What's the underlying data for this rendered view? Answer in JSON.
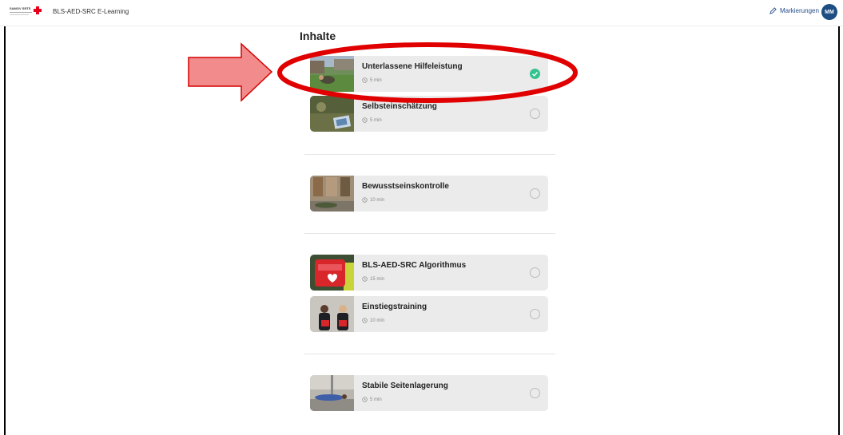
{
  "header": {
    "logo_text": "SAMOV SRTS",
    "app_title": "BLS-AED-SRC E-Learning",
    "markings_label": "Markierungen",
    "avatar_initials": "MM"
  },
  "content": {
    "section_title": "Inhalte",
    "items": [
      {
        "title": "Unterlassene Hilfeleistung",
        "duration": "5 min",
        "completed": true
      },
      {
        "title": "Selbsteinschätzung",
        "duration": "5 min",
        "completed": false
      },
      {
        "title": "Bewusstseinskontrolle",
        "duration": "10 min",
        "completed": false
      },
      {
        "title": "BLS-AED-SRC Algorithmus",
        "duration": "15 min",
        "completed": false
      },
      {
        "title": "Einstiegstraining",
        "duration": "10 min",
        "completed": false
      },
      {
        "title": "Stabile Seitenlagerung",
        "duration": "5 min",
        "completed": false
      }
    ]
  },
  "colors": {
    "completed": "#34c38f",
    "avatar_bg": "#1d4d82",
    "annotation": "#e00000",
    "arrow_fill": "#f28b8b"
  }
}
